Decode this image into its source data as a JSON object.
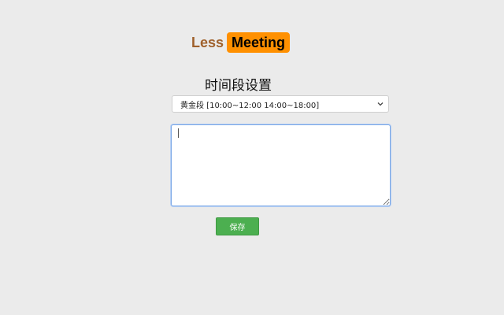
{
  "logo": {
    "part1": "Less",
    "part2": "Meeting",
    "part1_color": "#a0612c",
    "part2_bg": "#ff9000"
  },
  "section": {
    "title": "时间段设置"
  },
  "time_select": {
    "selected": "黄金段 [10:00~12:00 14:00~18:00]",
    "icon": "chevron-down-icon"
  },
  "textarea": {
    "value": "",
    "placeholder": ""
  },
  "save_button": {
    "label": "保存",
    "color": "#4caf50"
  }
}
